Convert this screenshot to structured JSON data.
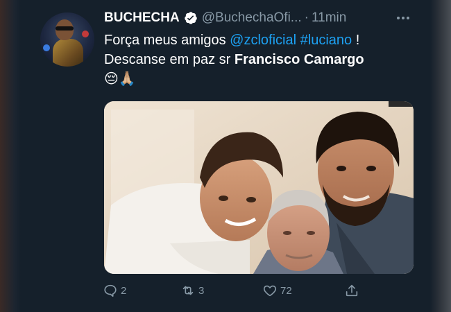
{
  "tweet": {
    "display_name": "BUCHECHA",
    "handle": "@BuchechaOfi...",
    "separator": "·",
    "time": "11min",
    "text": {
      "line1_prefix": "Força meus amigos ",
      "mention": "@zcloficial",
      "hashtag": "#luciano",
      "line1_suffix": " !",
      "line2_prefix": "Descanse em paz sr ",
      "line2_bold": "Francisco Camargo",
      "emojis": "😔🙏🏼"
    },
    "actions": {
      "reply_count": "2",
      "retweet_count": "3",
      "like_count": "72"
    }
  },
  "icons": {
    "verified": "verified-badge-icon",
    "more": "more-options-icon",
    "reply": "reply-icon",
    "retweet": "retweet-icon",
    "like": "heart-icon",
    "share": "share-icon"
  },
  "colors": {
    "background": "#15202b",
    "link": "#1da1f2",
    "muted": "#8899a6"
  }
}
